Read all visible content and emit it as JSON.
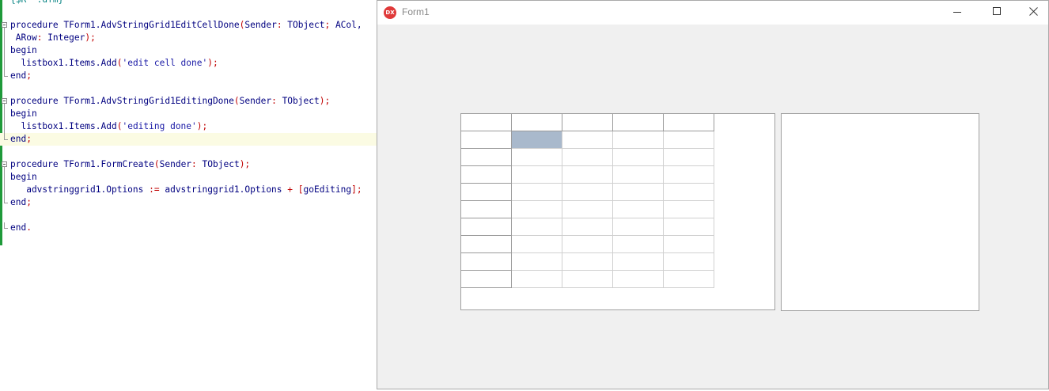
{
  "editor": {
    "lines": [
      {
        "segs": [
          {
            "t": "{$R *.dfm}",
            "c": "cm"
          }
        ]
      },
      {
        "segs": []
      },
      {
        "segs": [
          {
            "t": "procedure ",
            "c": "kw"
          },
          {
            "t": "TForm1.AdvStringGrid1EditCellDone",
            "c": "id"
          },
          {
            "t": "(",
            "c": "sym"
          },
          {
            "t": "Sender",
            "c": "id"
          },
          {
            "t": ": ",
            "c": "sym"
          },
          {
            "t": "TObject",
            "c": "id"
          },
          {
            "t": "; ",
            "c": "sym"
          },
          {
            "t": "ACol,",
            "c": "id"
          }
        ]
      },
      {
        "segs": [
          {
            "t": " ARow",
            "c": "id"
          },
          {
            "t": ": ",
            "c": "sym"
          },
          {
            "t": "Integer",
            "c": "id"
          },
          {
            "t": ");",
            "c": "sym"
          }
        ]
      },
      {
        "segs": [
          {
            "t": "begin",
            "c": "kw"
          }
        ]
      },
      {
        "segs": [
          {
            "t": "  listbox1.Items.Add",
            "c": "id"
          },
          {
            "t": "(",
            "c": "sym"
          },
          {
            "t": "'edit cell done'",
            "c": "str"
          },
          {
            "t": ");",
            "c": "sym"
          }
        ]
      },
      {
        "segs": [
          {
            "t": "end",
            "c": "kw"
          },
          {
            "t": ";",
            "c": "sym"
          }
        ]
      },
      {
        "segs": []
      },
      {
        "segs": [
          {
            "t": "procedure ",
            "c": "kw"
          },
          {
            "t": "TForm1.AdvStringGrid1EditingDone",
            "c": "id"
          },
          {
            "t": "(",
            "c": "sym"
          },
          {
            "t": "Sender",
            "c": "id"
          },
          {
            "t": ": ",
            "c": "sym"
          },
          {
            "t": "TObject",
            "c": "id"
          },
          {
            "t": ");",
            "c": "sym"
          }
        ]
      },
      {
        "segs": [
          {
            "t": "begin",
            "c": "kw"
          }
        ]
      },
      {
        "segs": [
          {
            "t": "  listbox1.Items.Add",
            "c": "id"
          },
          {
            "t": "(",
            "c": "sym"
          },
          {
            "t": "'editing done'",
            "c": "str"
          },
          {
            "t": ");",
            "c": "sym"
          }
        ]
      },
      {
        "segs": [
          {
            "t": "end",
            "c": "kw"
          },
          {
            "t": ";",
            "c": "sym"
          }
        ]
      },
      {
        "segs": []
      },
      {
        "segs": [
          {
            "t": "procedure ",
            "c": "kw"
          },
          {
            "t": "TForm1.FormCreate",
            "c": "id"
          },
          {
            "t": "(",
            "c": "sym"
          },
          {
            "t": "Sender",
            "c": "id"
          },
          {
            "t": ": ",
            "c": "sym"
          },
          {
            "t": "TObject",
            "c": "id"
          },
          {
            "t": ");",
            "c": "sym"
          }
        ]
      },
      {
        "segs": [
          {
            "t": "begin",
            "c": "kw"
          }
        ]
      },
      {
        "segs": [
          {
            "t": "   advstringgrid1.Options ",
            "c": "id"
          },
          {
            "t": ":= ",
            "c": "sym"
          },
          {
            "t": "advstringgrid1.Options ",
            "c": "id"
          },
          {
            "t": "+ [",
            "c": "sym"
          },
          {
            "t": "goEditing",
            "c": "id"
          },
          {
            "t": "];",
            "c": "sym"
          }
        ]
      },
      {
        "segs": [
          {
            "t": "end",
            "c": "kw"
          },
          {
            "t": ";",
            "c": "sym"
          }
        ]
      },
      {
        "segs": []
      },
      {
        "segs": [
          {
            "t": "end",
            "c": "kw"
          },
          {
            "t": ".",
            "c": "sym"
          }
        ]
      }
    ],
    "current_line": 11
  },
  "window": {
    "title": "Form1",
    "icon_text": "DX"
  },
  "grid": {
    "cols": 5,
    "rows": 10,
    "fixed_cols": 1,
    "fixed_rows": 1,
    "selected": {
      "row": 1,
      "col": 1
    },
    "selection_color": "#a9b9cc"
  },
  "listbox": {
    "items": []
  }
}
